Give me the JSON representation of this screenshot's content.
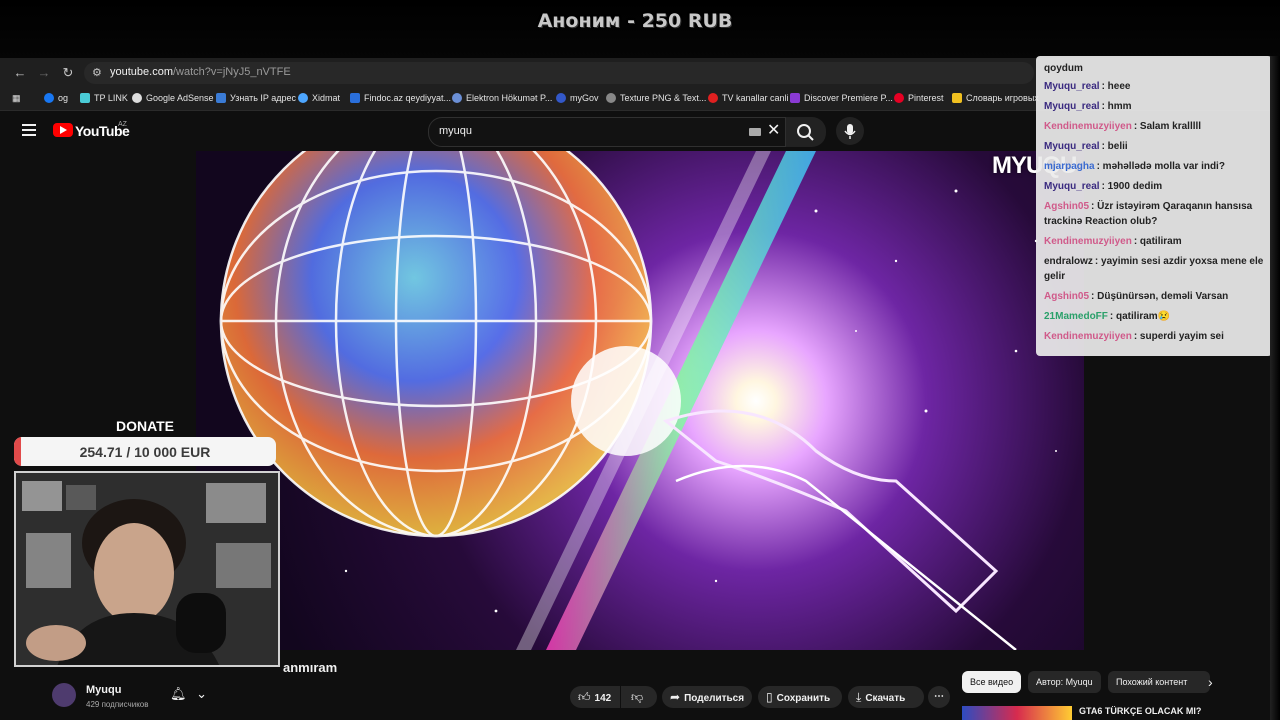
{
  "overlay": {
    "donation_alert": "Аноним - 250 RUB"
  },
  "browser": {
    "url_host": "youtube.com",
    "url_path": "/watch?v=jNyJ5_nVTFE",
    "bookmarks": [
      "og",
      "TP LINK",
      "Google AdSense",
      "Узнать IP адрес",
      "Xidmat",
      "Findoc.az qeydiyyat...",
      "Elektron Hökumət P...",
      "myGov",
      "Texture PNG & Text...",
      "TV kanallar canli",
      "Discover Premiere P...",
      "Pinterest",
      "Словарь игровых"
    ]
  },
  "youtube": {
    "logo_text": "YouTube",
    "country": "AZ",
    "search_value": "myuqu"
  },
  "video": {
    "watermark": "MYUQU",
    "title_fragment": "anmıram"
  },
  "donate": {
    "label": "DONATE",
    "progress_text": "254.71 / 10 000 EUR",
    "raised": 254.71,
    "goal": 10000
  },
  "channel": {
    "name": "Myuqu",
    "subscribers": "429 подписчиков"
  },
  "actions": {
    "likes": "142",
    "share": "Поделиться",
    "save": "Сохранить",
    "download": "Скачать"
  },
  "chips": [
    "Все видео",
    "Автор: Myuqu",
    "Похожий контент"
  ],
  "recommended": {
    "title": "GTA6 TÜRKÇE OLACAK MI?"
  },
  "chat": [
    {
      "user": "qoydum",
      "text": "",
      "color": "#222222"
    },
    {
      "user": "Myuqu_real",
      "text": ": heee",
      "color": "#3a2a80"
    },
    {
      "user": "Myuqu_real",
      "text": ": hmm",
      "color": "#3a2a80"
    },
    {
      "user": "Kendinemuzyiiyen",
      "text": ": Salam kralllll",
      "color": "#d05a8a"
    },
    {
      "user": "Myuqu_real",
      "text": ": belii",
      "color": "#3a2a80"
    },
    {
      "user": "mjarpagha",
      "text": ": məhəllədə molla var indi?",
      "color": "#3a6ad0"
    },
    {
      "user": "Myuqu_real",
      "text": ": 1900 dedim",
      "color": "#3a2a80"
    },
    {
      "user": "Agshin05",
      "text": ": Üzr istəyirəm Qaraqanın hansısa trackinə Reaction olub?",
      "color": "#d05a8a"
    },
    {
      "user": "Kendinemuzyiiyen",
      "text": ": qatiliram",
      "color": "#d05a8a"
    },
    {
      "user": "endralowz",
      "text": ": yayimin sesi azdir yoxsa mene ele gelir",
      "color": "#222222"
    },
    {
      "user": "Agshin05",
      "text": ": Düşünürsən, deməli Varsan",
      "color": "#d05a8a"
    },
    {
      "user": "21MamedoFF",
      "text": ": qatiliram😢",
      "color": "#2aa06a"
    },
    {
      "user": "Kendinemuzyiiyen",
      "text": ": superdi yayim sei",
      "color": "#d05a8a"
    }
  ]
}
